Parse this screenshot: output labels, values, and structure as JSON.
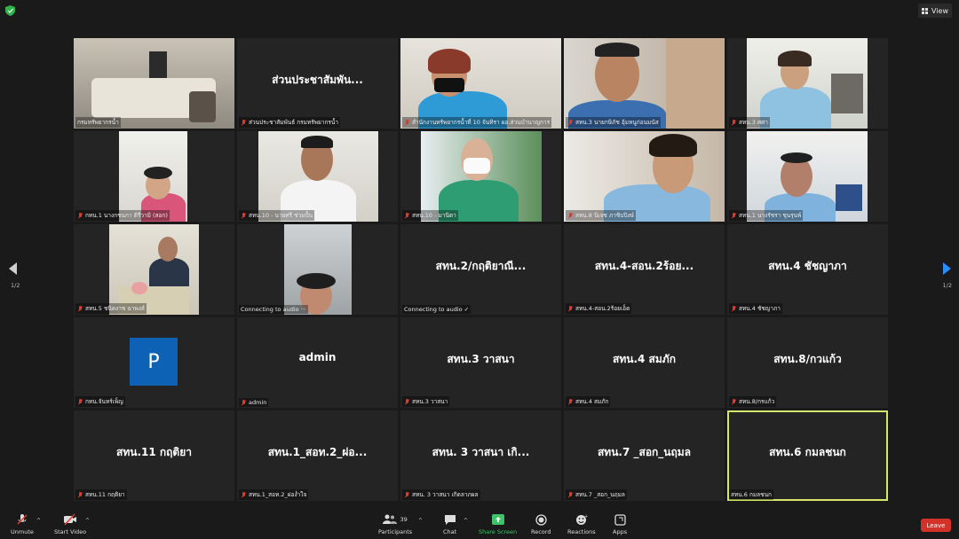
{
  "top": {
    "view_label": "View"
  },
  "gallery": {
    "tiles": [
      {
        "label": "กรมทรัพยากรน้ำ",
        "big": "",
        "muted": false
      },
      {
        "label": "ส่วนประชาสัมพันธ์ กรมทรัพยากรน้ำ",
        "big": "ส่วนประชาสัมพัน...",
        "muted": true
      },
      {
        "label": "สำนักงานทรัพยากรน้ำที่ 10 จันทิรา  ผอ.ส่วนบำนาญการ",
        "big": "",
        "muted": true
      },
      {
        "label": "สทน.3  นายกษิภัช อุ้มหนูก่อนมนัส",
        "big": "",
        "muted": true
      },
      {
        "label": "สทน.3   ศศา",
        "big": "",
        "muted": true
      },
      {
        "label": "กทน.1 นางกชนกา  ติรีวามิ (สอก)",
        "big": "",
        "muted": true
      },
      {
        "label": "สทน.10 - นายศรี ช่วมปั้น",
        "big": "",
        "muted": true
      },
      {
        "label": "สทน.10 - มานิตา",
        "big": "",
        "muted": true
      },
      {
        "label": "สทน.8 นิเจช ภาชิบปิงษ์",
        "big": "",
        "muted": true
      },
      {
        "label": "สทน.1 นางรัชรา ชุนรุนพ์",
        "big": "",
        "muted": true
      },
      {
        "label": "สทน.5 ชนิดงาช ฉาพงส์",
        "big": "",
        "muted": true
      },
      {
        "label": "Connecting to audio ···",
        "big": "",
        "muted": false
      },
      {
        "label": "Connecting to audio ✓",
        "big": "สทน.2/กฤติยาณี...",
        "muted": false
      },
      {
        "label": "สทน.4-สอน.2ร้อยเอ็ด",
        "big": "สทน.4-สอน.2ร้อย...",
        "muted": true
      },
      {
        "label": "สทน.4 ชัชญาภา",
        "big": "สทน.4 ชัชญาภา",
        "muted": true
      },
      {
        "label": "กทน.จันทร์เพ็ญ",
        "big": "",
        "muted": true
      },
      {
        "label": "admin",
        "big": "admin",
        "muted": true
      },
      {
        "label": "สทน.3 วาสนา",
        "big": "สทน.3 วาสนา",
        "muted": true
      },
      {
        "label": "สทน.4 สมภัก",
        "big": "สทน.4 สมภัก",
        "muted": true
      },
      {
        "label": "สทน.8/กรแก้ว",
        "big": "สทน.8/กวแก้ว",
        "muted": true
      },
      {
        "label": "สทน.11 กฤติยา",
        "big": "สทน.11 กฤติยา",
        "muted": true
      },
      {
        "label": "สทน.1_สอท.2_ผ่อง่ำใจ",
        "big": "สทน.1_สอท.2_ผ่อ...",
        "muted": true
      },
      {
        "label": "สทน. 3 วาสนา เกิดลาภผล",
        "big": "สทน. 3 วาสนา เกิ...",
        "muted": true
      },
      {
        "label": "สทน.7 _สอก_นฤมล",
        "big": "สทน.7 _สอก_นฤมล",
        "muted": true
      },
      {
        "label": "สทน.6 กมลชนก",
        "big": "สทน.6 กมลชนก",
        "muted": false
      }
    ],
    "avatar_initial": "P",
    "page_left": "1/2",
    "page_right": "1/2"
  },
  "toolbar": {
    "unmute": "Unmute",
    "start_video": "Start Video",
    "participants": "Participants",
    "participants_count": "39",
    "chat": "Chat",
    "share_screen": "Share Screen",
    "record": "Record",
    "reactions": "Reactions",
    "apps": "Apps",
    "leave": "Leave"
  },
  "colors": {
    "active_border": "#d6e66b",
    "leave": "#d23228",
    "share": "#3ec36b",
    "muted_mic": "#e0392d"
  }
}
